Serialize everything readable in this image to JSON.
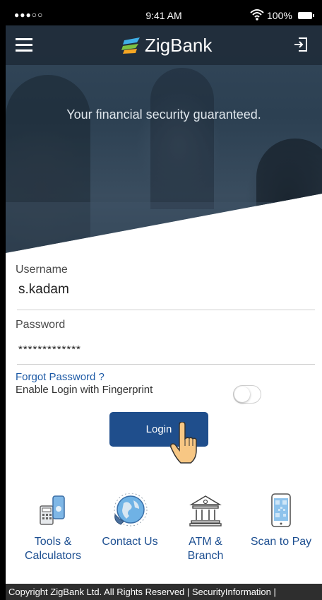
{
  "status_bar": {
    "signal": "●●●○○",
    "time": "9:41 AM",
    "battery": "100%"
  },
  "header": {
    "app_name": "ZigBank",
    "tagline": "Your financial security guaranteed."
  },
  "form": {
    "username_label": "Username",
    "username_value": "s.kadam",
    "password_label": "Password",
    "password_value": "*************",
    "forgot_link": "Forgot Password ?",
    "fingerprint_label": "Enable Login with Fingerprint",
    "fingerprint_enabled": false,
    "login_button": "Login"
  },
  "quick_links": [
    {
      "label_line1": "Tools &",
      "label_line2": "Calculators",
      "icon": "calculator-phone-icon"
    },
    {
      "label_line1": "Contact Us",
      "label_line2": "",
      "icon": "globe-contact-icon"
    },
    {
      "label_line1": "ATM &",
      "label_line2": "Branch",
      "icon": "bank-building-icon"
    },
    {
      "label_line1": "Scan to Pay",
      "label_line2": "",
      "icon": "qr-phone-icon"
    }
  ],
  "footer": {
    "text": "Copyright ZigBank Ltd. All Rights Reserved | SecurityInformation |"
  },
  "colors": {
    "primary": "#1f4e8c",
    "link": "#1d5aa6",
    "header_bg": "#202d3a",
    "footer_bg": "#2e2e2e"
  }
}
